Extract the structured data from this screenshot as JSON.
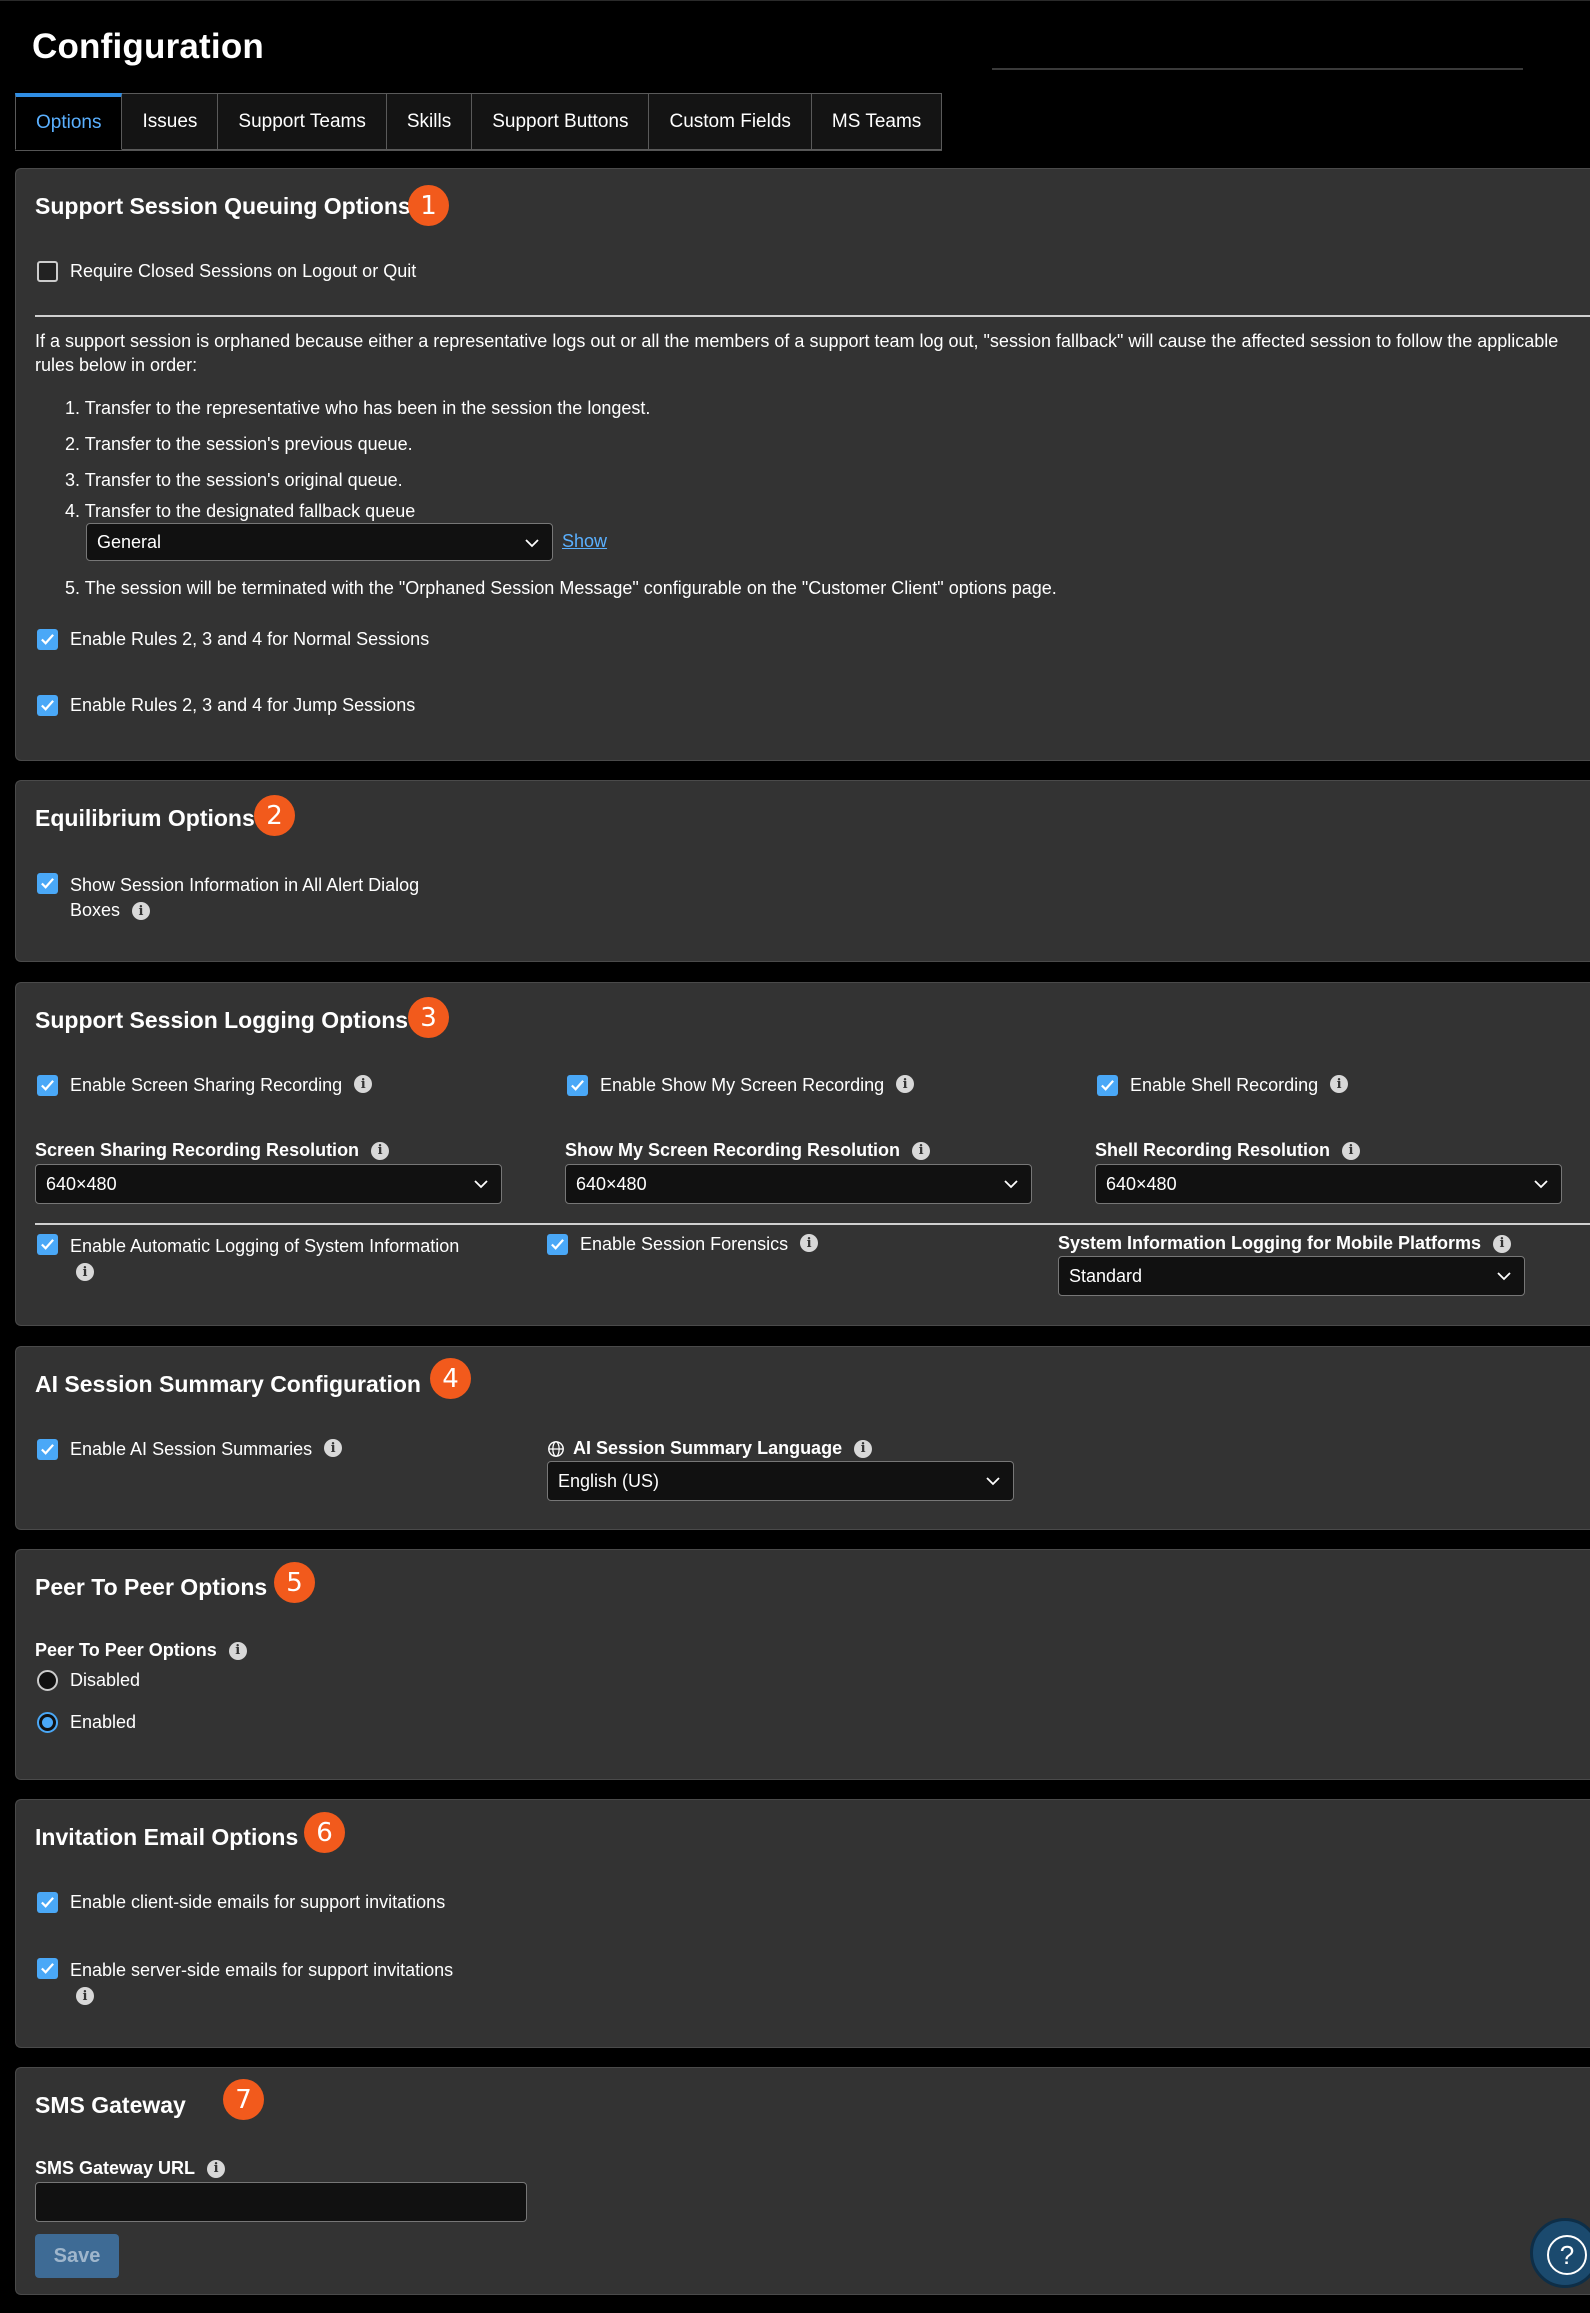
{
  "page": {
    "title": "Configuration"
  },
  "tabs": [
    "Options",
    "Issues",
    "Support Teams",
    "Skills",
    "Support Buttons",
    "Custom Fields",
    "MS Teams"
  ],
  "queuing": {
    "title": "Support Session Queuing Options",
    "badge": "1",
    "require_closed": "Require Closed Sessions on Logout or Quit",
    "description": "If a support session is orphaned because either a representative logs out or all the members of a support team log out, \"session fallback\" will cause the affected session to follow the applicable rules below in order:",
    "rules": [
      "1. Transfer to the representative who has been in the session the longest.",
      "2. Transfer to the session's previous queue.",
      "3. Transfer to the session's original queue.",
      "4. Transfer to the designated fallback queue",
      "5. The session will be terminated with the \"Orphaned Session Message\" configurable on the \"Customer Client\" options page."
    ],
    "fallback_queue": "General",
    "show_link": "Show",
    "normal_sessions": "Enable Rules 2, 3 and 4 for Normal Sessions",
    "jump_sessions": "Enable Rules 2, 3 and 4 for Jump Sessions"
  },
  "equilibrium": {
    "title": "Equilibrium Options",
    "badge": "2",
    "show_info_line1": "Show Session Information in All Alert Dialog",
    "show_info_line2": "Boxes"
  },
  "logging": {
    "title": "Support Session Logging Options",
    "badge": "3",
    "screen_sharing": "Enable Screen Sharing Recording",
    "show_my_screen": "Enable Show My Screen Recording",
    "shell": "Enable Shell Recording",
    "screen_res_label": "Screen Sharing Recording Resolution",
    "screen_res_value": "640×480",
    "show_res_label": "Show My Screen Recording Resolution",
    "show_res_value": "640×480",
    "shell_res_label": "Shell Recording Resolution",
    "shell_res_value": "640×480",
    "auto_logging": "Enable Automatic Logging of System Information",
    "forensics": "Enable Session Forensics",
    "mobile_label": "System Information Logging for Mobile Platforms",
    "mobile_value": "Standard"
  },
  "ai": {
    "title": "AI Session Summary Configuration",
    "badge": "4",
    "enable": "Enable AI Session Summaries",
    "language_label": "AI Session Summary Language",
    "language_value": "English (US)"
  },
  "p2p": {
    "title": "Peer To Peer Options",
    "badge": "5",
    "label": "Peer To Peer Options",
    "disabled": "Disabled",
    "enabled": "Enabled"
  },
  "invitation": {
    "title": "Invitation Email Options",
    "badge": "6",
    "client_side": "Enable client-side emails for support invitations",
    "server_side": "Enable server-side emails for support invitations"
  },
  "sms": {
    "title": "SMS Gateway",
    "badge": "7",
    "url_label": "SMS Gateway URL",
    "url_value": "",
    "save": "Save"
  },
  "colors": {
    "accent": "#4aa8f7",
    "badge": "#f25a1c",
    "panel": "#333333"
  }
}
